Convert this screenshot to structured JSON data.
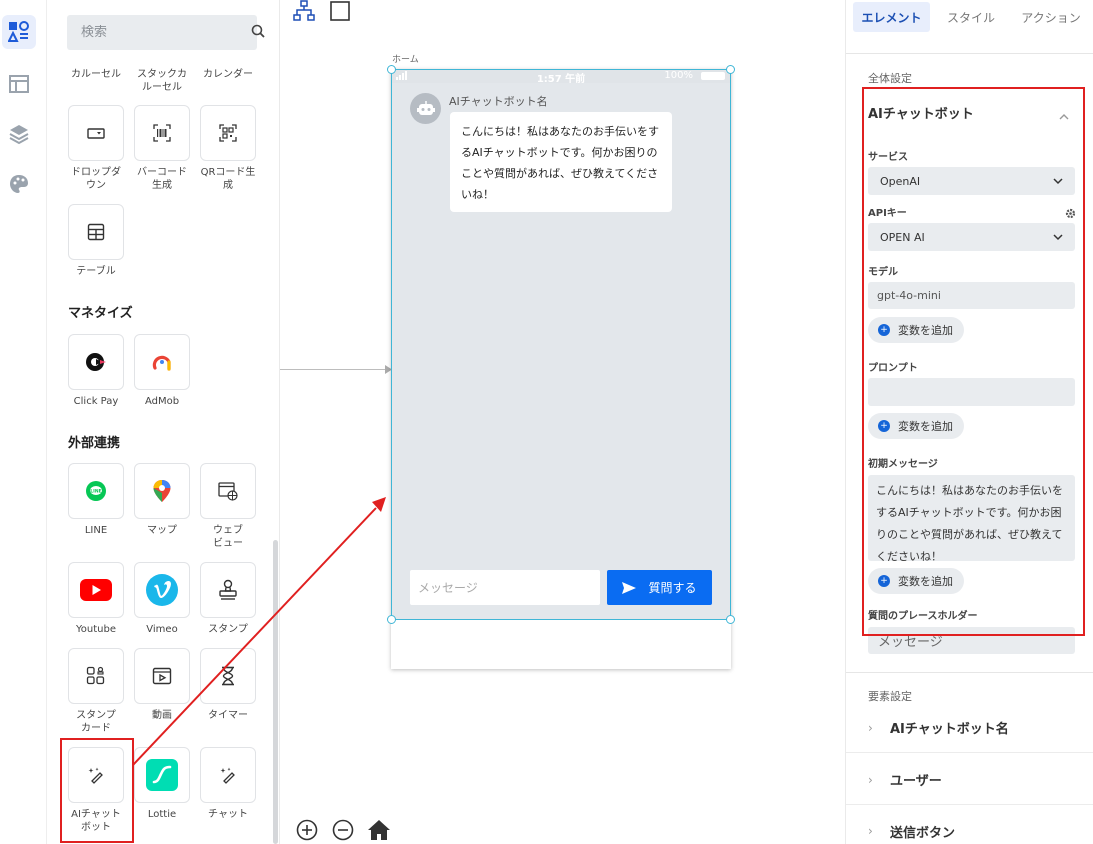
{
  "rail": {
    "items": [
      "components",
      "layout",
      "layers",
      "theme"
    ]
  },
  "component_panel": {
    "search_placeholder": "検索",
    "top_labels": [
      "カルーセル",
      "スタックカ\nルーセル",
      "カレンダー"
    ],
    "row1": [
      {
        "label": "ドロップダ\nウン",
        "icon": "dropdown-icon"
      },
      {
        "label": "バーコード\n生成",
        "icon": "barcode-icon"
      },
      {
        "label": "QRコード生\n成",
        "icon": "qrcode-icon"
      }
    ],
    "row2": [
      {
        "label": "テーブル",
        "icon": "table-icon"
      }
    ],
    "sections": {
      "monetize": "マネタイズ",
      "external": "外部連携"
    },
    "monetize_items": [
      {
        "label": "Click Pay",
        "icon": "clickpay-logo-icon"
      },
      {
        "label": "AdMob",
        "icon": "admob-logo-icon"
      }
    ],
    "external_items": [
      {
        "label": "LINE",
        "icon": "line-logo-icon"
      },
      {
        "label": "マップ",
        "icon": "map-pin-icon"
      },
      {
        "label": "ウェブ\nビュー",
        "icon": "webview-icon"
      },
      {
        "label": "Youtube",
        "icon": "youtube-logo-icon"
      },
      {
        "label": "Vimeo",
        "icon": "vimeo-logo-icon"
      },
      {
        "label": "スタンプ",
        "icon": "stamp-icon"
      },
      {
        "label": "スタンプ\nカード",
        "icon": "stamp-card-icon"
      },
      {
        "label": "動画",
        "icon": "video-icon"
      },
      {
        "label": "タイマー",
        "icon": "hourglass-icon"
      },
      {
        "label": "AIチャット\nボット",
        "icon": "ai-wand-icon"
      },
      {
        "label": "Lottie",
        "icon": "lottie-logo-icon"
      },
      {
        "label": "チャット",
        "icon": "chat-wand-icon"
      }
    ]
  },
  "canvas": {
    "screen_name": "ホーム",
    "status_time": "1:57 午前",
    "status_battery": "100%",
    "bot_name": "AIチャットボット名",
    "bot_message": "こんにちは！私はあなたのお手伝いをするAIチャットボットです。何かお困りのことや質問があれば、ぜひ教えてくださいね！",
    "message_placeholder": "メッセージ",
    "send_label": "質問する",
    "colors": {
      "accent": "#0a6cf2",
      "selection": "#3fb6d6",
      "annotation": "#e02020"
    }
  },
  "props": {
    "tabs": [
      "エレメント",
      "スタイル",
      "アクション"
    ],
    "global_settings": "全体設定",
    "section_title": "AIチャットボット",
    "service_label": "サービス",
    "service_value": "OpenAI",
    "apikey_label": "APIキー",
    "apikey_value": "OPEN AI",
    "model_label": "モデル",
    "model_value": "gpt-4o-mini",
    "add_variable": "変数を追加",
    "prompt_label": "プロンプト",
    "prompt_value": "",
    "initial_label": "初期メッセージ",
    "initial_value": "こんにちは！私はあなたのお手伝いをするAIチャットボットです。何かお困りのことや質問があれば、ぜひ教えてくださいね！",
    "placeholder_label": "質問のプレースホルダー",
    "placeholder_value": "メッセージ",
    "element_settings": "要素設定",
    "element_rows": [
      "AIチャットボット名",
      "ユーザー",
      "送信ボタン"
    ]
  }
}
